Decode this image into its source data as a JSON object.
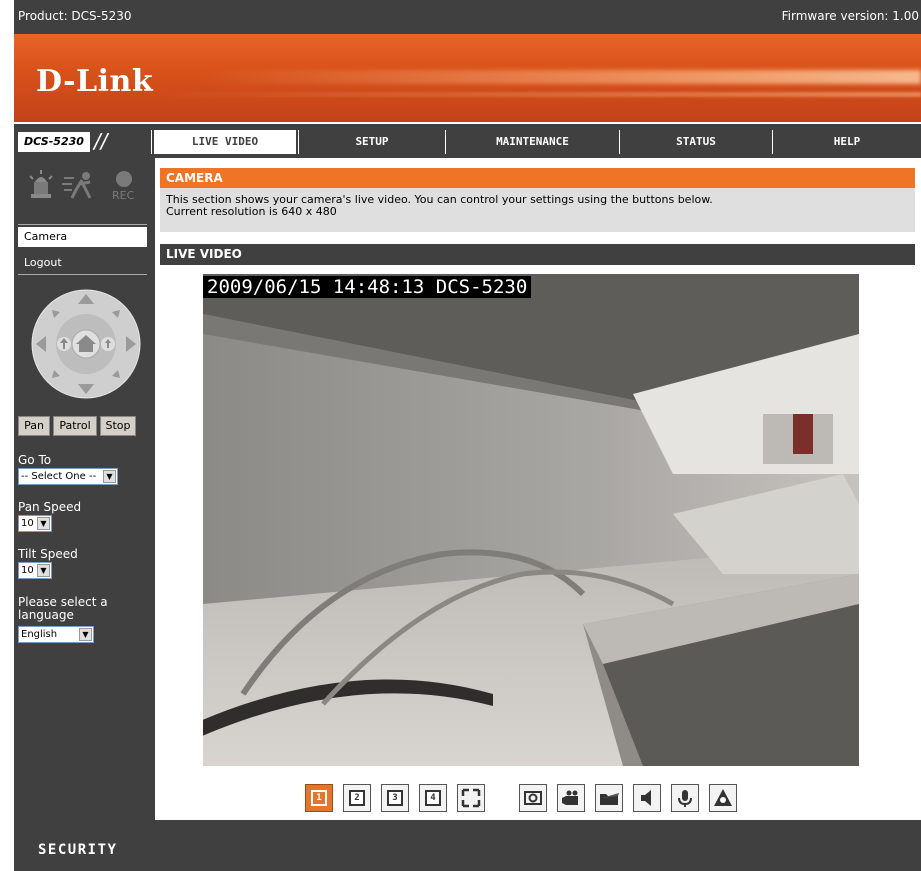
{
  "header": {
    "product": "Product: DCS-5230",
    "firmware": "Firmware version: 1.00",
    "logo": "D-Link"
  },
  "nav": {
    "model": "DCS-5230",
    "tabs": [
      {
        "label": "LIVE VIDEO"
      },
      {
        "label": "SETUP"
      },
      {
        "label": "MAINTENANCE"
      },
      {
        "label": "STATUS"
      },
      {
        "label": "HELP"
      }
    ]
  },
  "sidebar": {
    "status_icons": [
      "alarm-icon",
      "motion-icon",
      "rec-icon"
    ],
    "rec_label": "REC",
    "menu": [
      {
        "label": "Camera"
      },
      {
        "label": "Logout"
      }
    ],
    "ptz_icons": [
      "ptz-up-icon",
      "ptz-down-icon",
      "ptz-left-icon",
      "ptz-right-icon",
      "ptz-home-icon",
      "zoom-in-icon",
      "zoom-out-icon"
    ],
    "buttons": {
      "pan": "Pan",
      "patrol": "Patrol",
      "stop": "Stop"
    },
    "goto": {
      "label": "Go To",
      "value": "-- Select One --"
    },
    "pan_speed": {
      "label": "Pan Speed",
      "value": "10"
    },
    "tilt_speed": {
      "label": "Tilt Speed",
      "value": "10"
    },
    "language": {
      "label": "Please select a language",
      "value": "English"
    }
  },
  "camera_section": {
    "title": "CAMERA",
    "desc": "This section shows your camera's live video. You can control your settings using the buttons below.",
    "resolution": "Current resolution is 640 x 480"
  },
  "live_video": {
    "title": "LIVE VIDEO",
    "osd": "2009/06/15 14:48:13 DCS-5230"
  },
  "toolbar": [
    {
      "icon": "view1-icon",
      "glyph": "1",
      "active": true
    },
    {
      "icon": "view2-icon",
      "glyph": "2",
      "active": false
    },
    {
      "icon": "view3-icon",
      "glyph": "3",
      "active": false
    },
    {
      "icon": "view4-icon",
      "glyph": "4",
      "active": false
    },
    {
      "icon": "fullscreen-icon",
      "glyph": "",
      "active": false
    },
    {
      "icon": "snapshot-icon",
      "glyph": "",
      "active": false
    },
    {
      "icon": "record-icon",
      "glyph": "",
      "active": false
    },
    {
      "icon": "folder-icon",
      "glyph": "",
      "active": false
    },
    {
      "icon": "speaker-icon",
      "glyph": "",
      "active": false
    },
    {
      "icon": "microphone-icon",
      "glyph": "",
      "active": false
    },
    {
      "icon": "alarm-trigger-icon",
      "glyph": "",
      "active": false
    }
  ],
  "footer": {
    "label": "SECURITY"
  },
  "colors": {
    "accent": "#f07426",
    "dark": "#404040",
    "panel": "#dfdfdf"
  }
}
